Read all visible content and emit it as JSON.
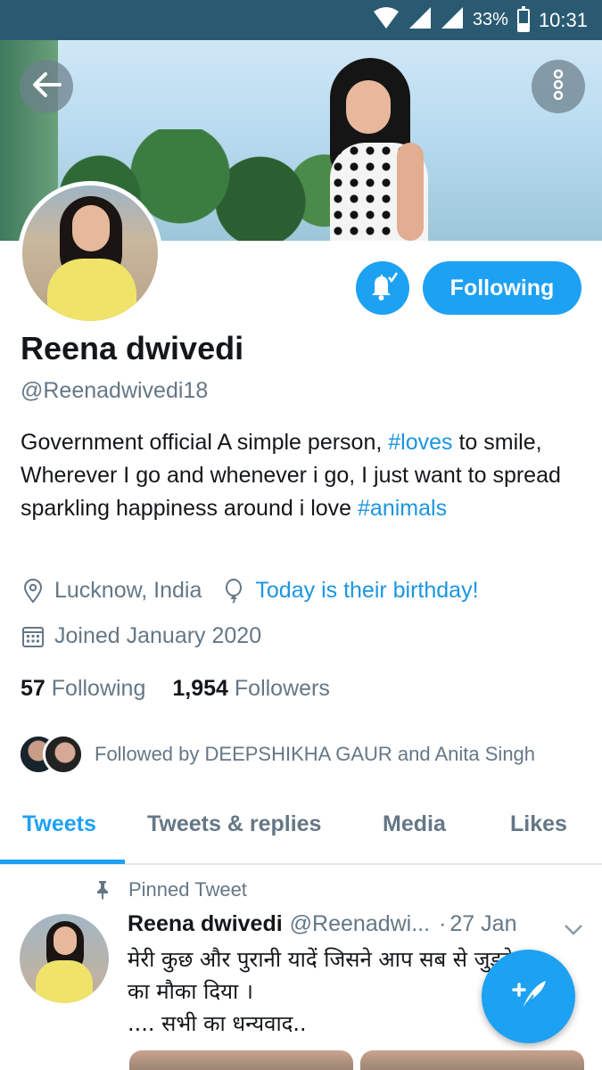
{
  "status_bar": {
    "battery_pct": "33%",
    "battery_level": 0.33,
    "time": "10:31",
    "icons": [
      "wifi-icon",
      "signal-icon",
      "signal-icon",
      "battery-icon"
    ]
  },
  "header": {
    "back_icon": "arrow-left-icon",
    "more_icon": "more-vertical-icon"
  },
  "profile": {
    "name": "Reena dwivedi",
    "handle": "@Reenadwivedi18",
    "bio_parts": {
      "p1": "Government official A simple person, ",
      "tag1": "#loves",
      "p2": " to smile,  Wherever I go and whenever i go, I just want to spread sparkling happiness  around i love ",
      "tag2": "#animals"
    },
    "location": "Lucknow, India",
    "birthday": "Today is their birthday!",
    "joined": "Joined January 2020",
    "following_count": "57",
    "following_label": "Following",
    "followers_count": "1,954",
    "followers_label": "Followers",
    "followed_by": "Followed by DEEPSHIKHA GAUR and Anita Singh"
  },
  "actions": {
    "notify_icon": "bell-check-icon",
    "following_button": "Following"
  },
  "tabs": [
    {
      "label": "Tweets",
      "active": true
    },
    {
      "label": "Tweets & replies",
      "active": false
    },
    {
      "label": "Media",
      "active": false
    },
    {
      "label": "Likes",
      "active": false
    }
  ],
  "pinned": {
    "label": "Pinned Tweet",
    "icon": "pin-icon"
  },
  "tweet": {
    "name": "Reena dwivedi",
    "handle": "@Reenadwi...",
    "dot": "·",
    "date": "27 Jan",
    "text": "मेरी कुछ और पुरानी यादें जिसने आप सब से जुड़ने\nका मौका दिया ।\n .... सभी का धन्यवाद.."
  },
  "fab": {
    "icon": "compose-feather-icon"
  },
  "colors": {
    "accent": "#1da1f2",
    "link": "#1b95e0",
    "secondary_text": "#657786",
    "status_bar": "#2a5a72"
  }
}
